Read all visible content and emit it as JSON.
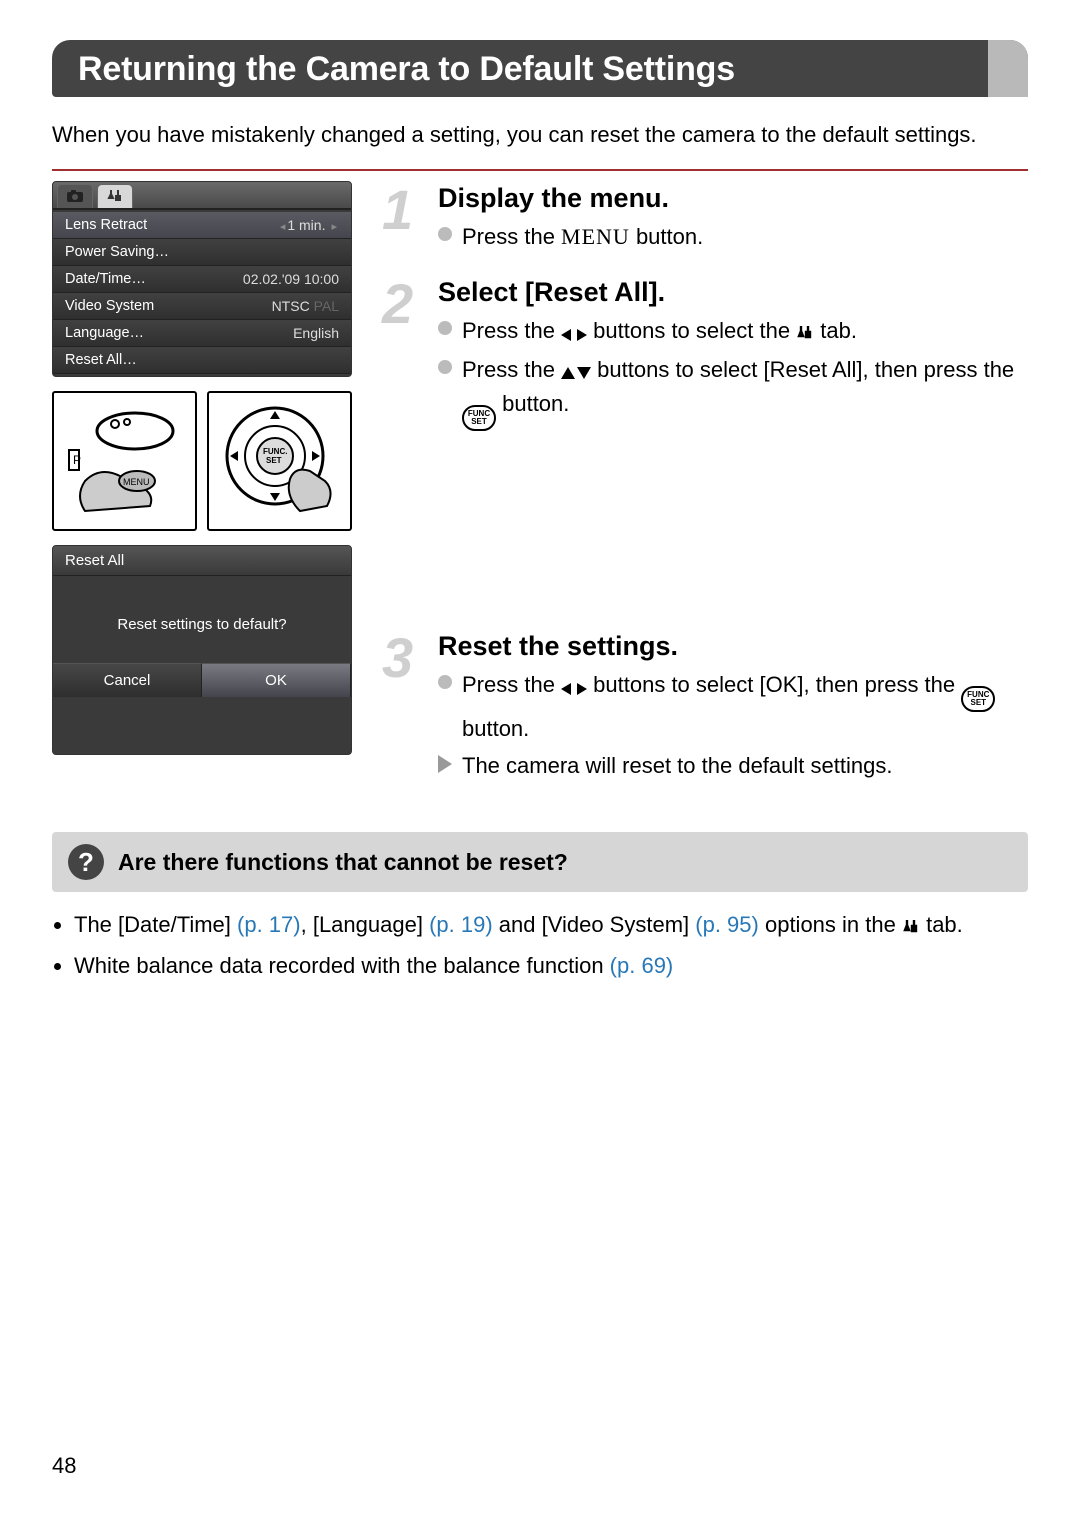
{
  "title": "Returning the Camera to Default Settings",
  "intro": "When you have mistakenly changed a setting, you can reset the camera to the default settings.",
  "menu": {
    "rows": [
      {
        "label": "Lens Retract",
        "value": "1 min."
      },
      {
        "label": "Power Saving…",
        "value": ""
      },
      {
        "label": "Date/Time…",
        "value": "02.02.'09 10:00"
      },
      {
        "label": "Video System",
        "value": "NTSC",
        "alt": "PAL"
      },
      {
        "label": "Language…",
        "value": "English"
      },
      {
        "label": "Reset All…",
        "value": ""
      }
    ]
  },
  "confirm": {
    "header": "Reset All",
    "message": "Reset settings to default?",
    "cancel": "Cancel",
    "ok": "OK"
  },
  "steps": {
    "s1": {
      "num": "1",
      "title": "Display the menu.",
      "body": "Press the ",
      "body2": " button.",
      "menu_word": "MENU"
    },
    "s2": {
      "num": "2",
      "title": "Select [Reset All].",
      "l1a": "Press the ",
      "l1b": " buttons to select the ",
      "l1c": " tab.",
      "l2a": "Press the ",
      "l2b": " buttons to select [Reset All], then press the ",
      "l2c": " button."
    },
    "s3": {
      "num": "3",
      "title": "Reset the settings.",
      "l1a": "Press the ",
      "l1b": " buttons to select [OK], then press the ",
      "l1c": " button.",
      "l2": "The camera will reset to the default settings."
    }
  },
  "callout": "Are there functions that cannot be reset?",
  "notes": {
    "n1a": "The [Date/Time] ",
    "p1": "(p. 17)",
    "n1b": ", [Language] ",
    "p2": "(p. 19)",
    "n1c": " and [Video System] ",
    "p3": "(p. 95)",
    "n1d": " options in the ",
    "n1e": " tab.",
    "n2a": "White balance data recorded with the balance function ",
    "p4": "(p. 69)"
  },
  "func_label": "FUNC\nSET",
  "page": "48"
}
